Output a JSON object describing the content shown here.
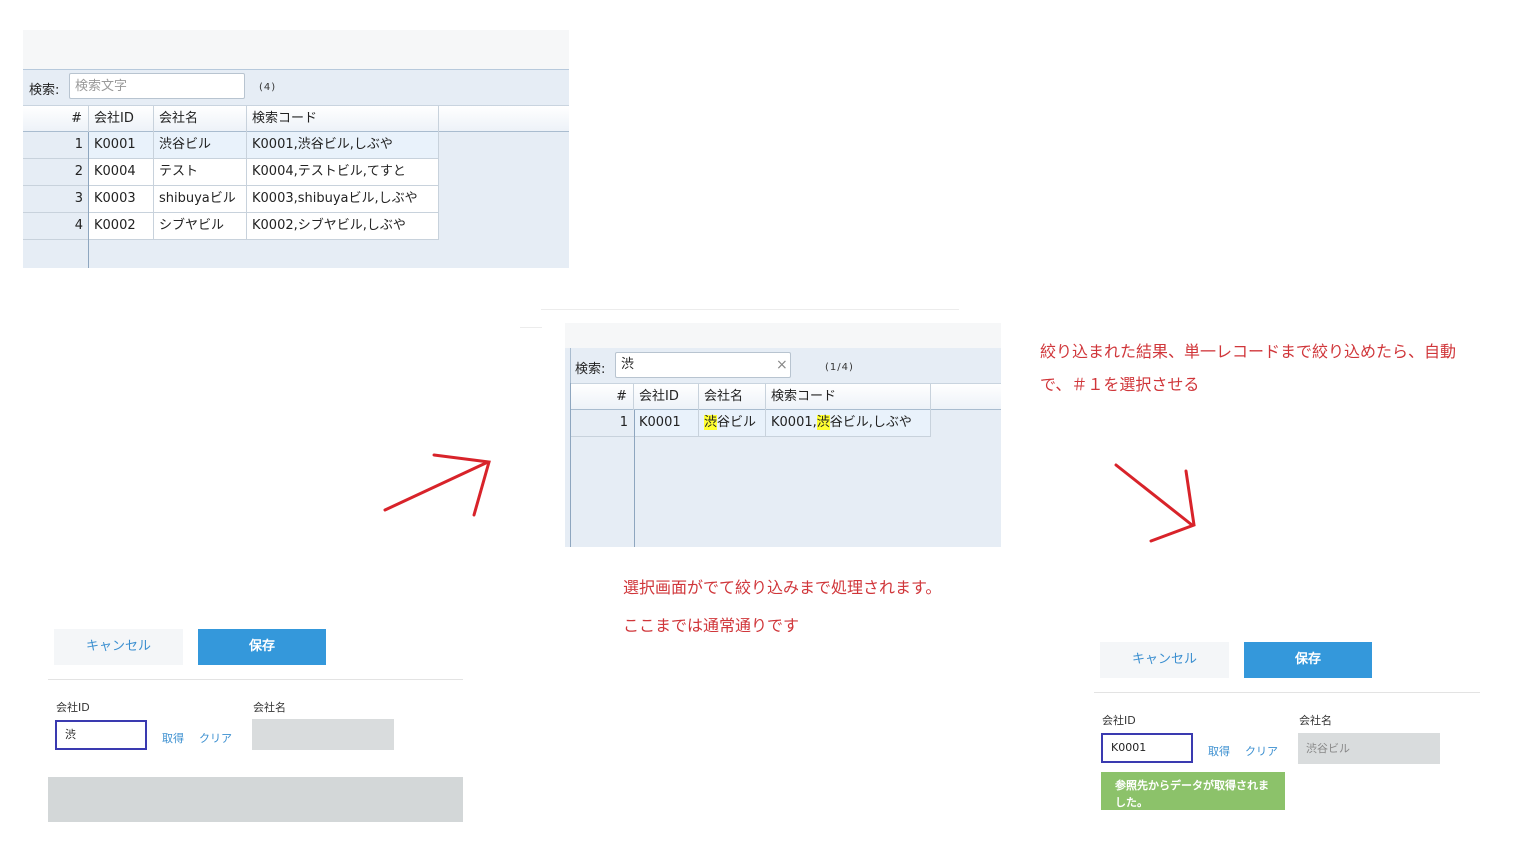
{
  "grid1": {
    "search_label": "検索:",
    "search_placeholder": "検索文字",
    "search_value": "",
    "count": "(4)",
    "headers": [
      "#",
      "会社ID",
      "会社名",
      "検索コード"
    ],
    "rows": [
      {
        "num": "1",
        "id": "K0001",
        "name": "渋谷ビル",
        "code": "K0001,渋谷ビル,しぶや"
      },
      {
        "num": "2",
        "id": "K0004",
        "name": "テスト",
        "code": "K0004,テストビル,てすと"
      },
      {
        "num": "3",
        "id": "K0003",
        "name": "shibuyaビル",
        "code": "K0003,shibuyaビル,しぶや"
      },
      {
        "num": "4",
        "id": "K0002",
        "name": "シブヤビル",
        "code": "K0002,シブヤビル,しぶや"
      }
    ]
  },
  "grid2": {
    "search_label": "検索:",
    "search_value": "渋",
    "count": "(1/4)",
    "headers": [
      "#",
      "会社ID",
      "会社名",
      "検索コード"
    ],
    "row": {
      "num": "1",
      "id": "K0001",
      "name_hl": "渋",
      "name_rest": "谷ビル",
      "code_pre": "K0001,",
      "code_hl": "渋",
      "code_rest": "谷ビル,しぶや"
    }
  },
  "form1": {
    "cancel_label": "キャンセル",
    "save_label": "保存",
    "id_label": "会社ID",
    "name_label": "会社名",
    "id_value": "渋",
    "get_link": "取得",
    "clear_link": "クリア",
    "name_value": ""
  },
  "form2": {
    "cancel_label": "キャンセル",
    "save_label": "保存",
    "id_label": "会社ID",
    "name_label": "会社名",
    "id_value": "K0001",
    "get_link": "取得",
    "clear_link": "クリア",
    "name_value": "渋谷ビル",
    "message": "参照先からデータが取得されました。"
  },
  "notes": {
    "middle_line1": "選択画面がでて絞り込みまで処理されます。",
    "middle_line2": "ここまでは通常通りです",
    "right_line1": "絞り込まれた結果、単一レコードまで絞り込めたら、自動",
    "right_line2": "で、＃１を選択させる"
  },
  "colors": {
    "annotation": "#d0363a",
    "arrow": "#d8232a",
    "save_button": "#3498db",
    "highlight": "#ffff33",
    "success": "#8cc26a"
  }
}
